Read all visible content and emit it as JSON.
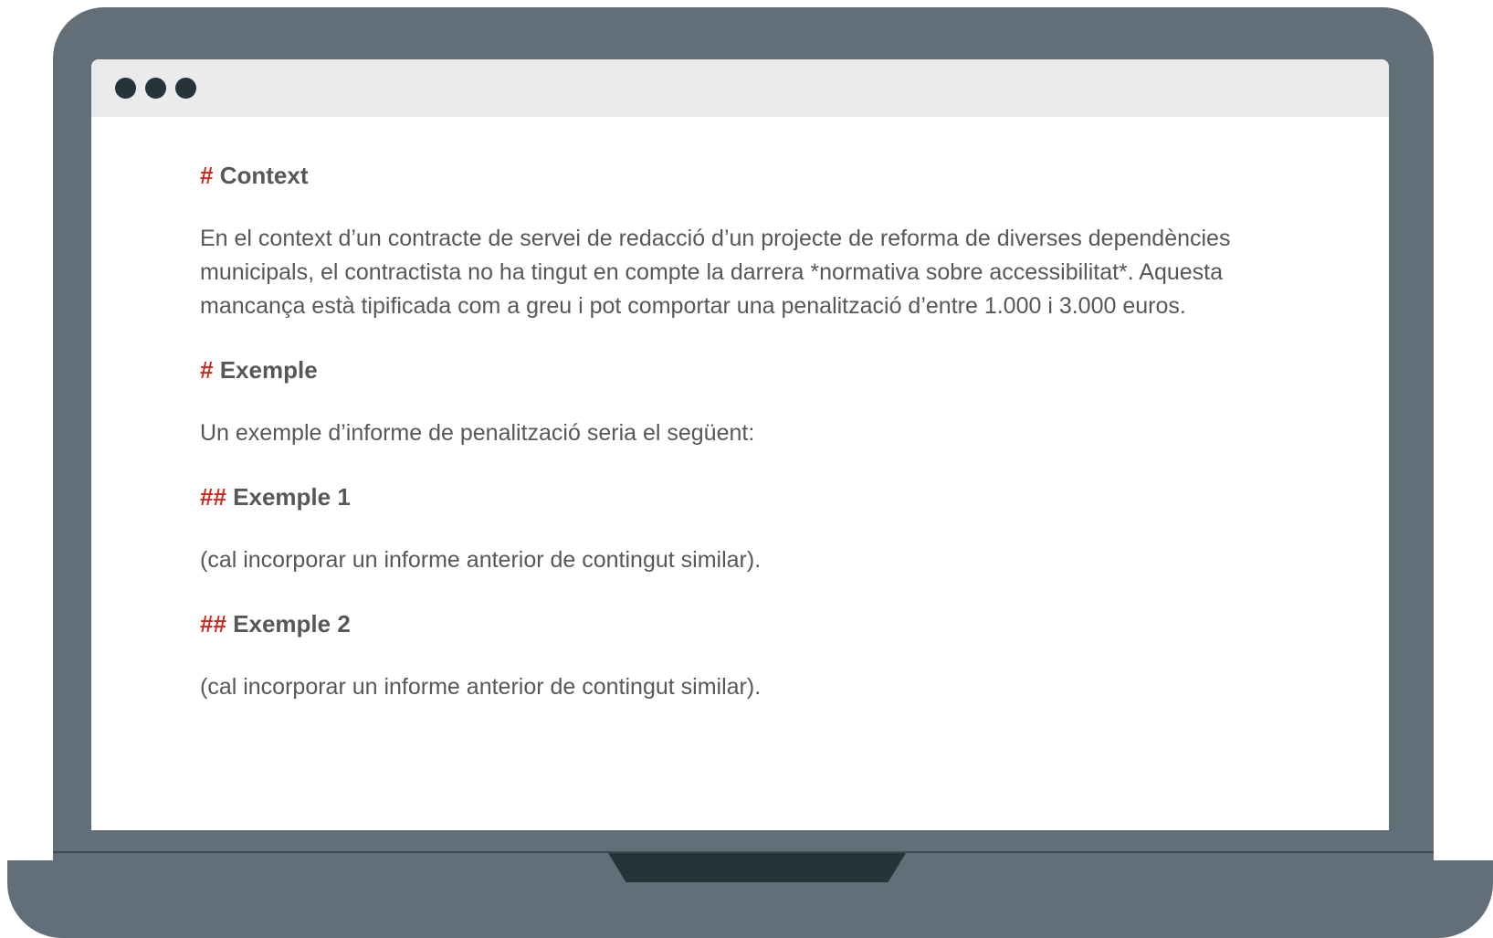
{
  "window": {
    "controls": [
      "dot-1",
      "dot-2",
      "dot-3"
    ]
  },
  "colors": {
    "bezel": "#636f78",
    "hash_accent": "#d0281e",
    "text": "#55585b",
    "titlebar": "#ebebeb",
    "dots": "#27333b"
  },
  "document": {
    "context": {
      "marker": "#",
      "title": "Context",
      "body": "En el context d’un contracte de servei de redacció d’un projecte de reforma de diverses dependències municipals, el contractista no ha tingut en compte la darrera *normativa sobre accessibilitat*. Aquesta mancança està tipificada com a greu i pot comportar una penalització d’entre 1.000 i 3.000 euros."
    },
    "example": {
      "marker": "#",
      "title": "Exemple",
      "body": "Un exemple d’informe de penalització seria el següent:"
    },
    "example1": {
      "marker": "##",
      "title": "Exemple 1",
      "body": "(cal incorporar un informe anterior de contingut similar)."
    },
    "example2": {
      "marker": "##",
      "title": "Exemple 2",
      "body": "(cal incorporar un informe anterior de contingut similar)."
    }
  }
}
